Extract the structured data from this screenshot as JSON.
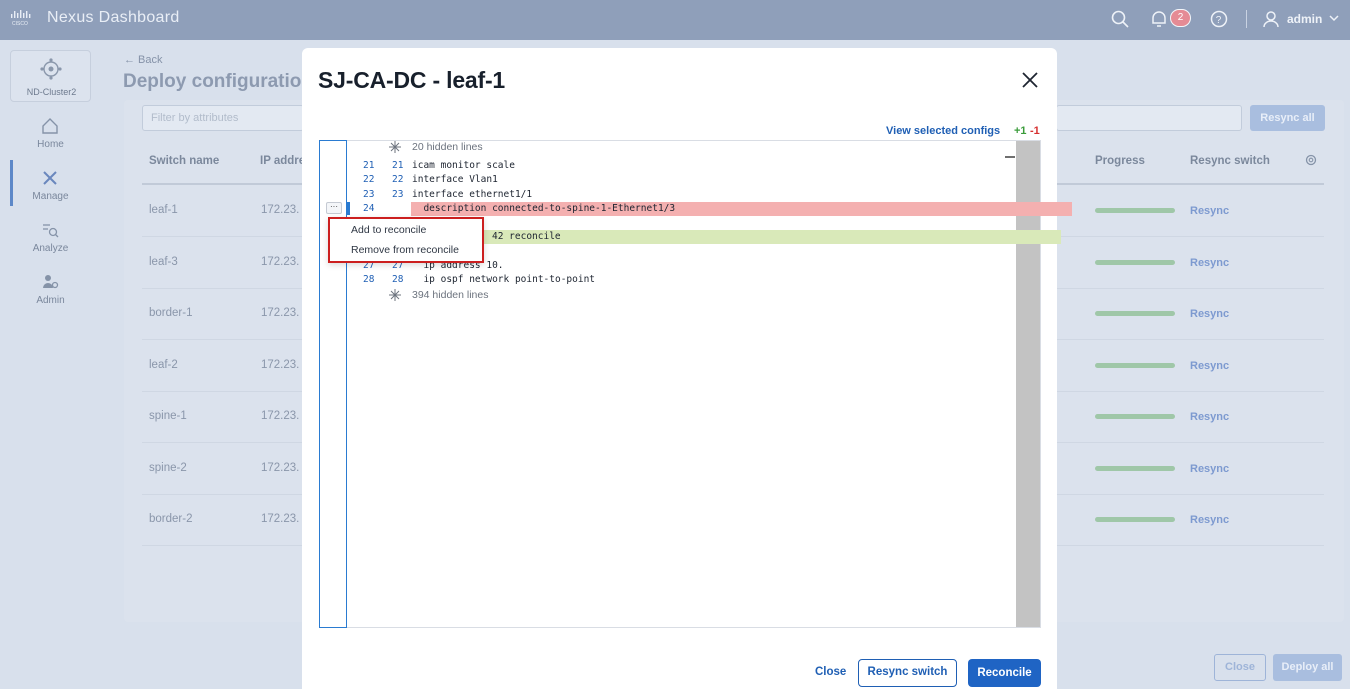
{
  "topbar": {
    "app_title": "Nexus Dashboard",
    "notification_count": "2",
    "user": "admin"
  },
  "sidebar": {
    "cluster": "ND-Cluster2",
    "items": [
      {
        "label": "Home",
        "icon": "home-icon"
      },
      {
        "label": "Manage",
        "icon": "tools-icon"
      },
      {
        "label": "Analyze",
        "icon": "analyze-icon"
      },
      {
        "label": "Admin",
        "icon": "admin-icon"
      }
    ]
  },
  "page": {
    "back": "← Back",
    "title": "Deploy configuration",
    "filter_placeholder": "Filter by attributes",
    "resync_all": "Resync all",
    "columns": {
      "name": "Switch name",
      "ip": "IP addre",
      "progress": "Progress",
      "resync": "Resync switch"
    },
    "rows": [
      {
        "name": "leaf-1",
        "ip": "172.23.",
        "action": "Resync"
      },
      {
        "name": "leaf-3",
        "ip": "172.23.",
        "action": "Resync"
      },
      {
        "name": "border-1",
        "ip": "172.23.",
        "action": "Resync"
      },
      {
        "name": "leaf-2",
        "ip": "172.23.",
        "action": "Resync"
      },
      {
        "name": "spine-1",
        "ip": "172.23.",
        "action": "Resync"
      },
      {
        "name": "spine-2",
        "ip": "172.23.",
        "action": "Resync"
      },
      {
        "name": "border-2",
        "ip": "172.23.",
        "action": "Resync"
      }
    ],
    "close": "Close",
    "deploy_all": "Deploy all"
  },
  "modal": {
    "title": "SJ-CA-DC - leaf-1",
    "view_selected": "View selected configs",
    "added_count": "+1",
    "removed_count": "-1",
    "hidden_top": "20 hidden lines",
    "hidden_bottom": "394 hidden lines",
    "lines": [
      {
        "old": "21",
        "new": "21",
        "text": "icam monitor scale"
      },
      {
        "old": "22",
        "new": "22",
        "text": "interface Vlan1"
      },
      {
        "old": "23",
        "new": "23",
        "text": "interface ethernet1/1"
      },
      {
        "old": "24",
        "new": "",
        "text": "  description connected-to-spine-1-Ethernet1/3"
      },
      {
        "old": "",
        "new": "",
        "text": "42 reconcile"
      },
      {
        "old": "27",
        "new": "27",
        "text": "  ip address 10."
      },
      {
        "old": "28",
        "new": "28",
        "text": "  ip ospf network point-to-point"
      }
    ],
    "context_menu": [
      "Add to reconcile",
      "Remove from reconcile"
    ],
    "ellipsis": "···",
    "close": "Close",
    "resync_switch": "Resync switch",
    "reconcile": "Reconcile"
  }
}
